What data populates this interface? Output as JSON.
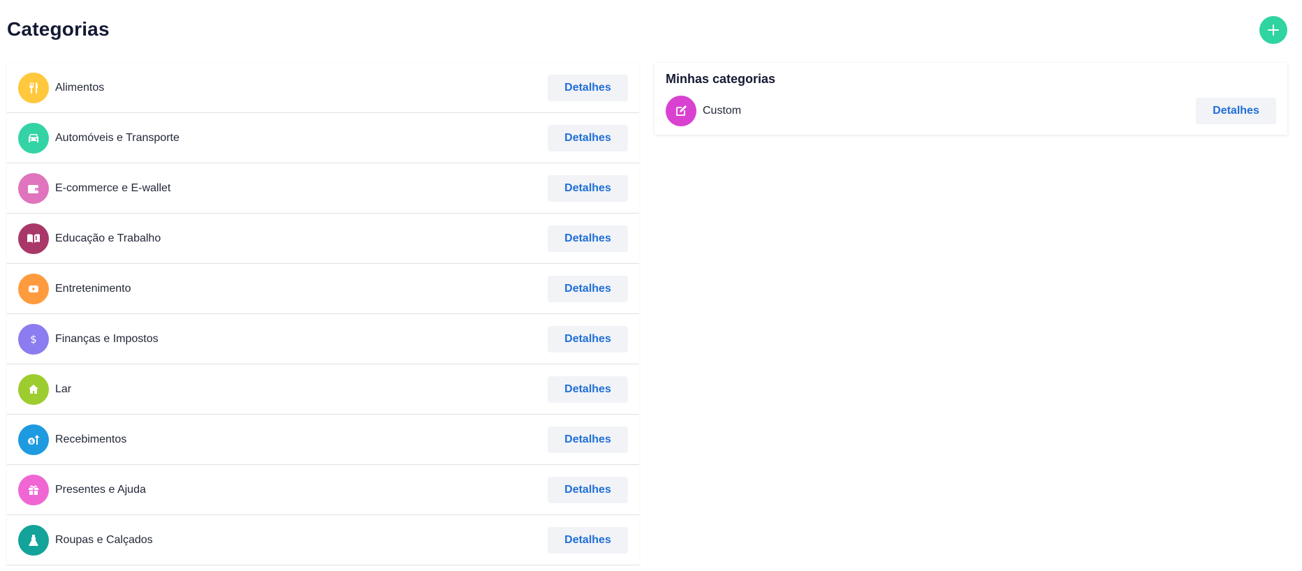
{
  "page": {
    "title": "Categorias",
    "add_button_icon": "plus-icon"
  },
  "categories": [
    {
      "label": "Alimentos",
      "icon": "utensils-icon",
      "color": "#ffc83d",
      "button": "Detalhes"
    },
    {
      "label": "Automóveis e Transporte",
      "icon": "car-icon",
      "color": "#34d3a6",
      "button": "Detalhes"
    },
    {
      "label": "E-commerce e E-wallet",
      "icon": "wallet-icon",
      "color": "#e074bd",
      "button": "Detalhes"
    },
    {
      "label": "Educação e Trabalho",
      "icon": "book-icon",
      "color": "#a93869",
      "button": "Detalhes"
    },
    {
      "label": "Entretenimento",
      "icon": "play-icon",
      "color": "#ff9b3f",
      "button": "Detalhes"
    },
    {
      "label": "Finanças e Impostos",
      "icon": "dollar-icon",
      "color": "#8b7cf0",
      "button": "Detalhes"
    },
    {
      "label": "Lar",
      "icon": "home-icon",
      "color": "#9ccc2e",
      "button": "Detalhes"
    },
    {
      "label": "Recebimentos",
      "icon": "money-up-icon",
      "color": "#1e9ae0",
      "button": "Detalhes"
    },
    {
      "label": "Presentes e Ajuda",
      "icon": "gift-icon",
      "color": "#f067d4",
      "button": "Detalhes"
    },
    {
      "label": "Roupas e Calçados",
      "icon": "dress-icon",
      "color": "#14a39a",
      "button": "Detalhes"
    }
  ],
  "my_categories": {
    "title": "Minhas categorias",
    "items": [
      {
        "label": "Custom",
        "icon": "edit-icon",
        "color": "#d942d0",
        "button": "Detalhes"
      }
    ]
  },
  "colors": {
    "accent": "#2fd4a0",
    "link": "#1f6fd6",
    "button_bg": "#f1f3f7"
  }
}
